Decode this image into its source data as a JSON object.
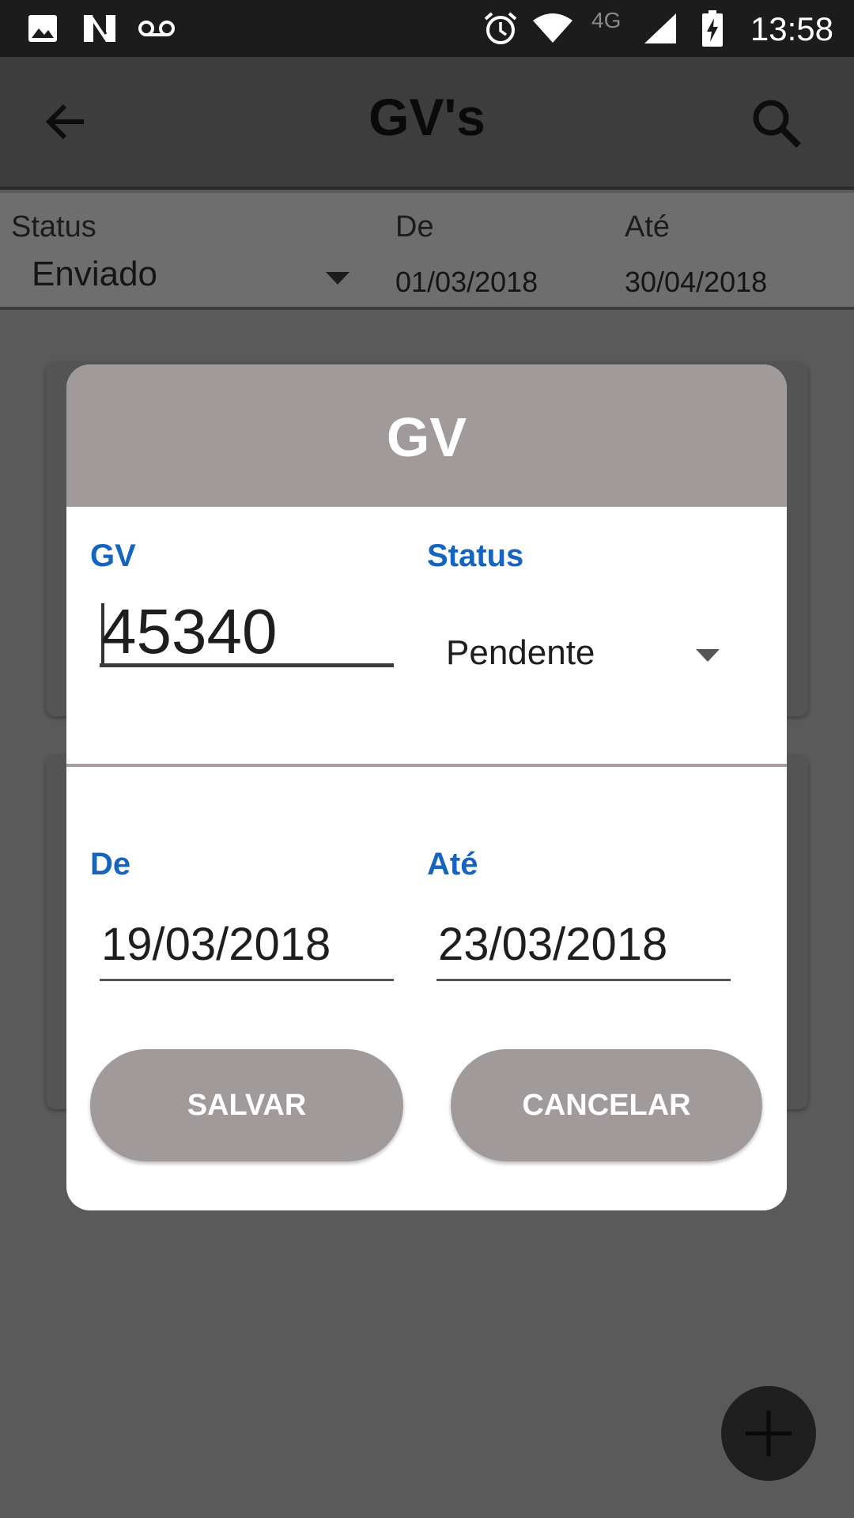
{
  "status_bar": {
    "time": "13:58",
    "network": "4G",
    "icons": [
      "image-icon",
      "n-icon",
      "voicemail-icon",
      "alarm-icon",
      "wifi-icon",
      "signal-icon",
      "battery-charging-icon"
    ]
  },
  "app_bar": {
    "title": "GV's",
    "back_icon": "arrow-left-icon",
    "search_icon": "search-icon"
  },
  "filters": {
    "status_label": "Status",
    "status_value": "Enviado",
    "from_label": "De",
    "from_value": "01/03/2018",
    "to_label": "Até",
    "to_value": "30/04/2018"
  },
  "dialog": {
    "title": "GV",
    "gv_label": "GV",
    "gv_value": "45340",
    "status_label": "Status",
    "status_value": "Pendente",
    "from_label": "De",
    "from_value": "19/03/2018",
    "to_label": "Até",
    "to_value": "23/03/2018",
    "save_label": "SALVAR",
    "cancel_label": "CANCELAR"
  },
  "fab": {
    "icon": "plus-icon"
  },
  "colors": {
    "accent_blue": "#1565c0",
    "dialog_header": "#a19a9b",
    "button": "#a19a9b"
  }
}
